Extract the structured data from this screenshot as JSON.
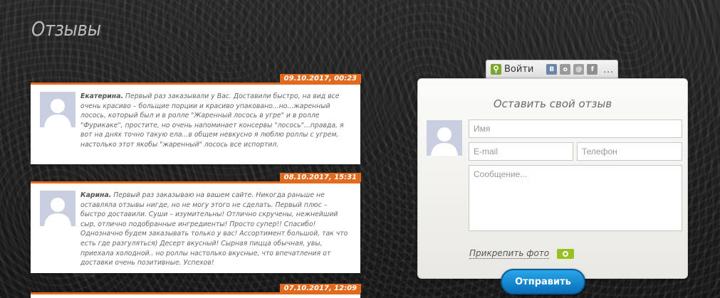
{
  "page": {
    "title": "Отзывы"
  },
  "reviews": [
    {
      "date": "09.10.2017, 00:23",
      "author": "Екатерина.",
      "text": " Первый раз заказывали у Вас. Доставили быстро, на вид все очень красиво – больщие порции и красиво упаковано...но...жаренный лосось, который был и в ролле \"Жаренный лосось в угре\" и в ролле \"Фурикаке\", простите, но очень напоминает консервы \"лосось\"...правда, я вот на днях точно такую ела...в общем невкусно я люблю роллы с угрем, настолько этот якобы \"жаренный\" лосось все испортил."
    },
    {
      "date": "08.10.2017, 15:31",
      "author": "Карина.",
      "text": " Первый раз заказываю на вашем сайте. Никогда раньше не оставляла отзывы нигде, но не могу этого не сделать. Первый плюс – быстро доставили. Суши – изумительны! Отлично скручены, нежнейший сыр, отлично подобранные ингредиенты! Просто супер!! Спасибо! Однозначно будем заказывать только у вас! Ассортимент большой, так что есть где разгуляться) Десерт вкусный! Сырная пицца обычная, увы, приехала холодной.. но роллы настолько вкусные, что впечатления от доставки очень позитивные. Успехов!"
    },
    {
      "date": "07.10.2017, 12:09",
      "author": "",
      "text": ""
    }
  ],
  "login": {
    "label": "Войти",
    "socials": [
      "vk-icon",
      "odnoklassniki-icon",
      "mailru-icon",
      "facebook-icon"
    ],
    "more": "..."
  },
  "form": {
    "title": "Оставить свой отзыв",
    "name_placeholder": "Имя",
    "email_placeholder": "E-mail",
    "phone_placeholder": "Телефон",
    "message_placeholder": "Сообщение...",
    "attach_label": "Прикрепить фото",
    "submit_label": "Отправить"
  },
  "colors": {
    "accent": "#e06a1d",
    "button": "#1a8ed6",
    "camera": "#95c21e"
  }
}
